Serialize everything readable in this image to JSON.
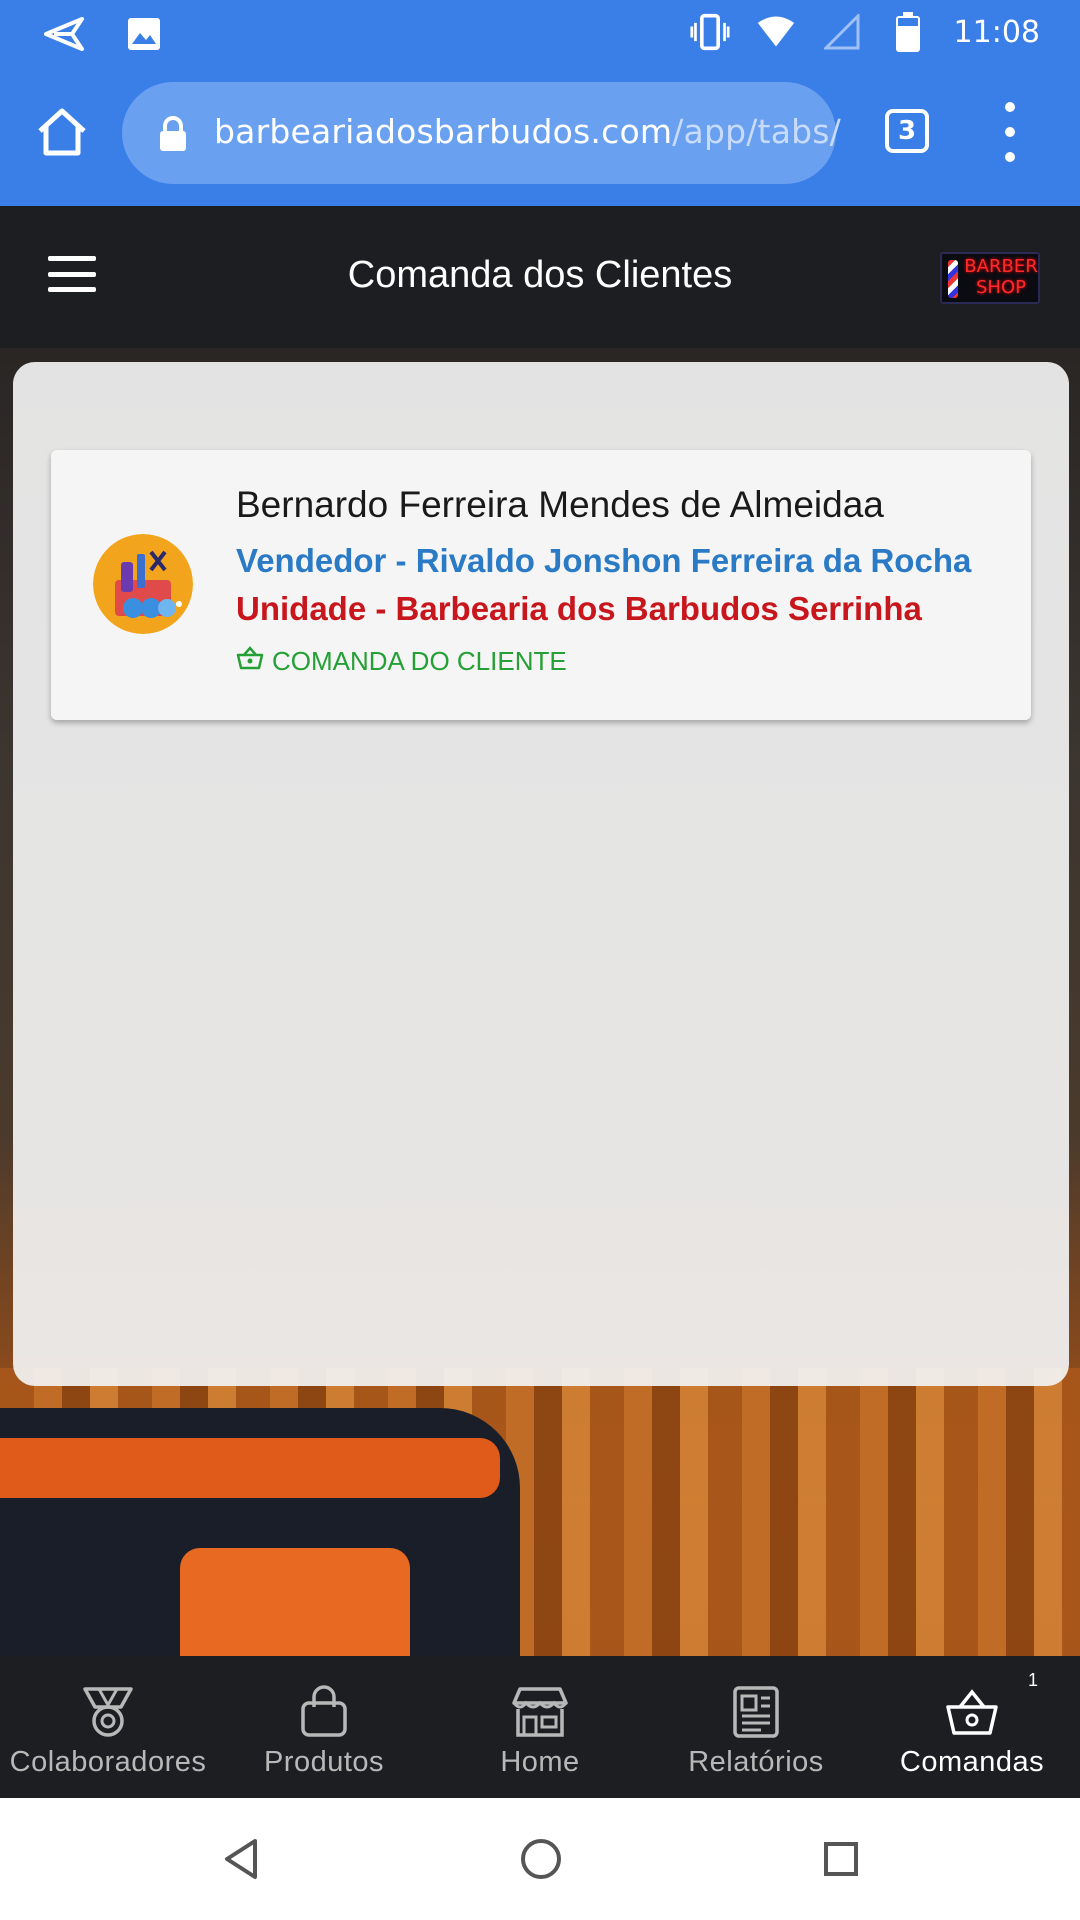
{
  "status_bar": {
    "time": "11:08",
    "left_icons": [
      "send-icon",
      "image-icon"
    ],
    "right_icons": [
      "vibrate-icon",
      "wifi-icon",
      "signal-icon",
      "battery-icon"
    ]
  },
  "browser": {
    "url_host": "barbeariadosbarbudos.com",
    "url_path": "/app/tabs/",
    "tab_count": "3"
  },
  "app_header": {
    "title": "Comanda dos Clientes",
    "logo_text": "BARBER SHOP"
  },
  "comanda": {
    "client_name": "Bernardo Ferreira Mendes de Almeidaa",
    "seller": "Vendedor - Rivaldo Jonshon Ferreira da Rocha",
    "unit": "Unidade - Barbearia dos Barbudos Serrinha",
    "tag": "COMANDA DO CLIENTE",
    "tag_color": "#25a035",
    "seller_color": "#2a7ac6",
    "unit_color": "#c8161d"
  },
  "tabs": [
    {
      "label": "Colaboradores",
      "icon": "medal-icon"
    },
    {
      "label": "Produtos",
      "icon": "shopping-bag-icon"
    },
    {
      "label": "Home",
      "icon": "storefront-icon"
    },
    {
      "label": "Relatórios",
      "icon": "newspaper-icon"
    },
    {
      "label": "Comandas",
      "icon": "basket-icon",
      "badge": "1",
      "active": true
    }
  ],
  "colors": {
    "browser_blue": "#3a7ee8",
    "app_dark": "#1c1e21"
  }
}
